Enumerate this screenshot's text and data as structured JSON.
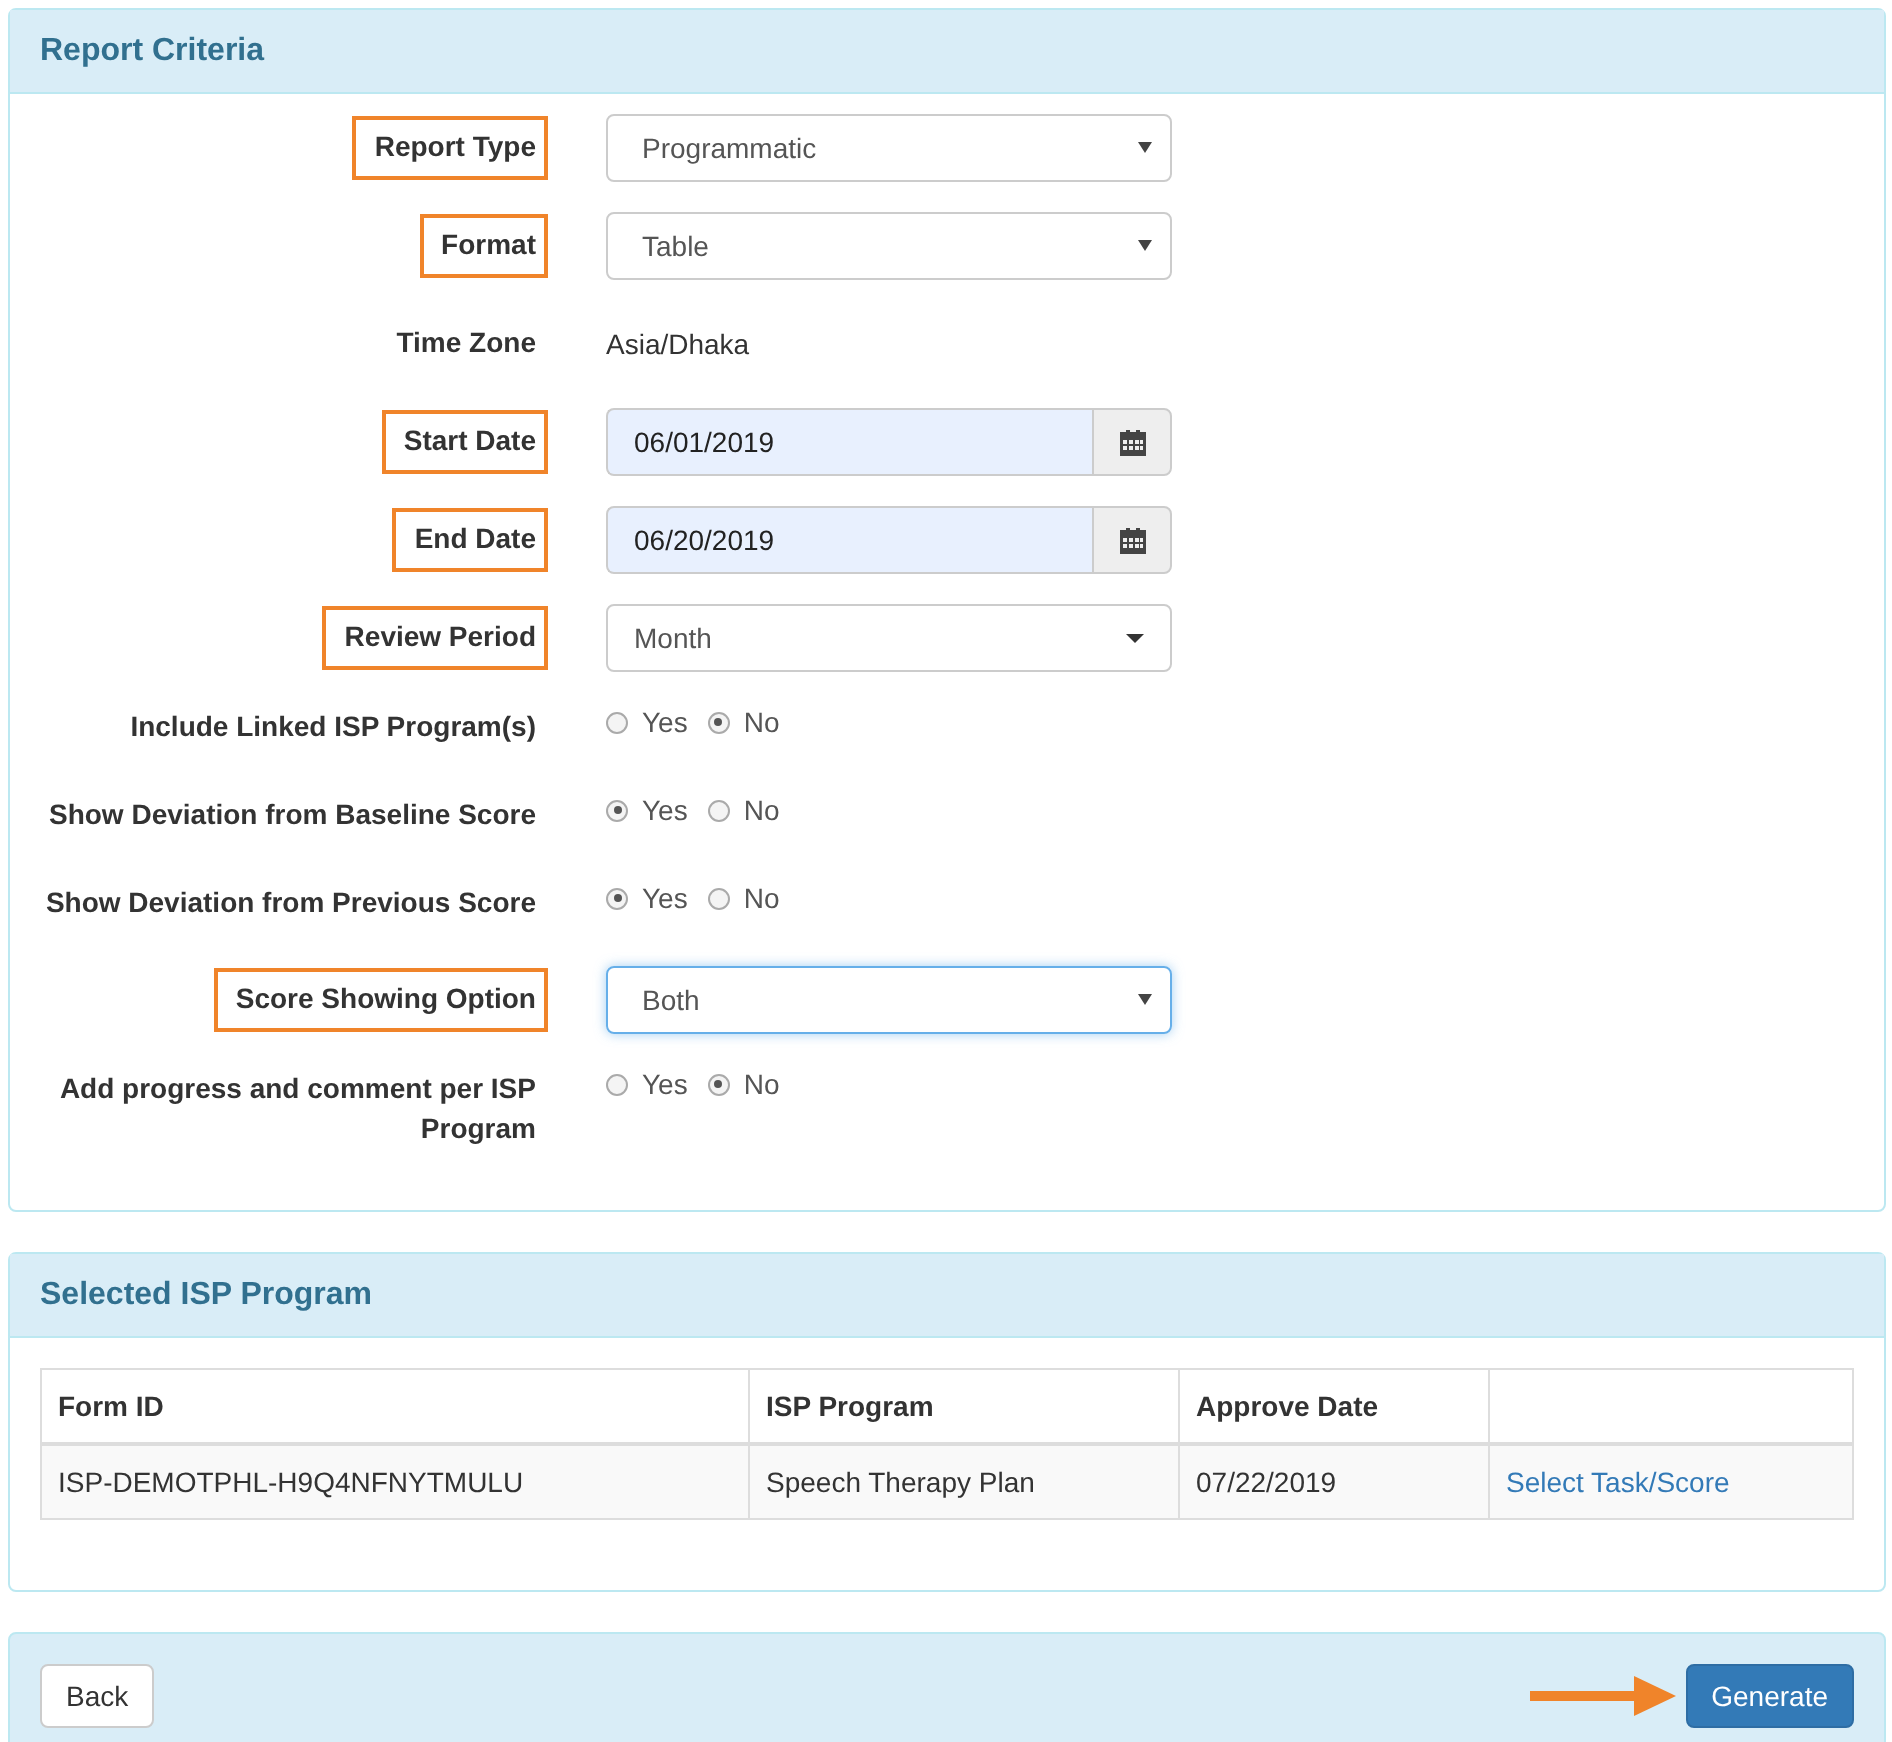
{
  "criteria": {
    "title": "Report Criteria",
    "fields": [
      {
        "kind": "select",
        "label": "Report Type",
        "highlighted": true,
        "value": "Programmatic",
        "focused": false
      },
      {
        "kind": "select",
        "label": "Format",
        "highlighted": true,
        "value": "Table",
        "focused": false
      },
      {
        "kind": "text",
        "label": "Time Zone",
        "highlighted": false,
        "value": "Asia/Dhaka"
      },
      {
        "kind": "date",
        "label": "Start Date",
        "highlighted": true,
        "value": "06/01/2019"
      },
      {
        "kind": "date",
        "label": "End Date",
        "highlighted": true,
        "value": "06/20/2019"
      },
      {
        "kind": "dropdown",
        "label": "Review Period",
        "highlighted": true,
        "value": "Month"
      },
      {
        "kind": "radio",
        "label": "Include Linked ISP Program(s)",
        "highlighted": false,
        "options": [
          {
            "label": "Yes",
            "selected": false
          },
          {
            "label": "No",
            "selected": true
          }
        ]
      },
      {
        "kind": "radio",
        "label": "Show Deviation from Baseline Score",
        "highlighted": false,
        "options": [
          {
            "label": "Yes",
            "selected": true
          },
          {
            "label": "No",
            "selected": false
          }
        ]
      },
      {
        "kind": "radio",
        "label": "Show Deviation from Previous Score",
        "highlighted": false,
        "options": [
          {
            "label": "Yes",
            "selected": true
          },
          {
            "label": "No",
            "selected": false
          }
        ]
      },
      {
        "kind": "select",
        "label": "Score Showing Option",
        "highlighted": true,
        "value": "Both",
        "focused": true
      },
      {
        "kind": "radio",
        "label": "Add progress and comment per ISP Program",
        "highlighted": false,
        "options": [
          {
            "label": "Yes",
            "selected": false
          },
          {
            "label": "No",
            "selected": true
          }
        ]
      }
    ]
  },
  "selected_program": {
    "title": "Selected ISP Program",
    "columns": [
      "Form ID",
      "ISP Program",
      "Approve Date"
    ],
    "rows": [
      {
        "cells": [
          "ISP-DEMOTPHL-H9Q4NFNYTMULU",
          "Speech Therapy Plan",
          "07/22/2019"
        ],
        "link": "Select Task/Score"
      }
    ]
  },
  "footer": {
    "back": "Back",
    "generate": "Generate",
    "arrow": true
  }
}
